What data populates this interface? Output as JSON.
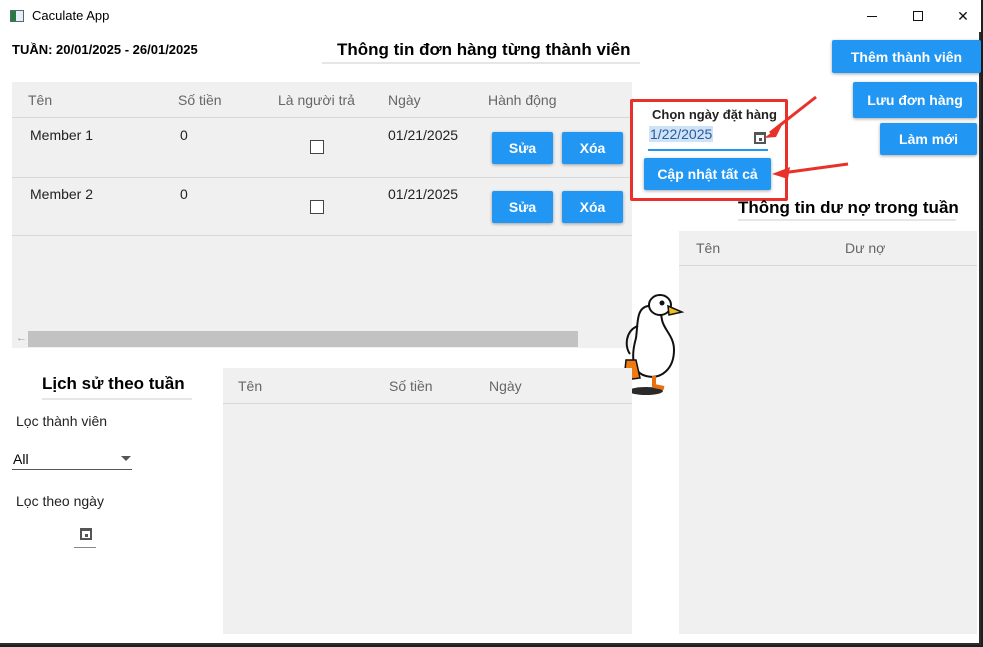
{
  "window": {
    "title": "Caculate App"
  },
  "week_label": "TUẦN: 20/01/2025 - 26/01/2025",
  "headings": {
    "orders": "Thông tin đơn hàng từng thành viên",
    "debt": "Thông tin dư nợ trong tuần",
    "history": "Lịch sử theo tuần"
  },
  "buttons": {
    "add_member": "Thêm thành viên",
    "save_order": "Lưu đơn hàng",
    "refresh": "Làm mới",
    "update_all": "Cập nhật tất cả"
  },
  "orders_table": {
    "columns": [
      "Tên",
      "Số tiền",
      "Là người trả",
      "Ngày",
      "Hành động"
    ],
    "rows": [
      {
        "name": "Member 1",
        "amount": "0",
        "is_payer": false,
        "date": "01/21/2025",
        "edit": "Sửa",
        "delete": "Xóa"
      },
      {
        "name": "Member 2",
        "amount": "0",
        "is_payer": false,
        "date": "01/21/2025",
        "edit": "Sửa",
        "delete": "Xóa"
      }
    ]
  },
  "order_date": {
    "label": "Chọn ngày đặt hàng",
    "value": "1/22/2025"
  },
  "debt_table": {
    "columns": [
      "Tên",
      "Dư nợ"
    ]
  },
  "history_table": {
    "columns": [
      "Tên",
      "Số tiền",
      "Ngày"
    ]
  },
  "filters": {
    "member_label": "Lọc thành viên",
    "member_value": "All",
    "date_label": "Lọc theo ngày"
  },
  "colors": {
    "accent": "#2196f3",
    "annotation": "#e8312a",
    "panel": "#f0f0f0"
  }
}
